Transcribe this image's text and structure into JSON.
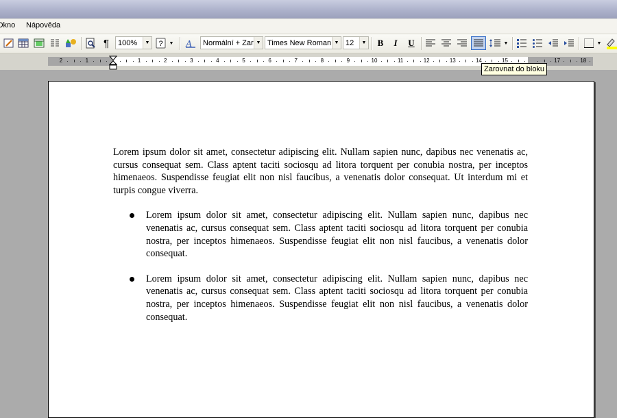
{
  "menu": {
    "items": [
      {
        "label": "Okno"
      },
      {
        "label": "Nápověda"
      }
    ]
  },
  "toolbar": {
    "zoom": "100%",
    "style": "Normální + Zarc",
    "font": "Times New Roman",
    "size": "12",
    "bold_label": "B",
    "italic_label": "I",
    "underline_label": "U",
    "pilcrow": "¶",
    "help_label": "?"
  },
  "ruler": {
    "numbers": [
      "2",
      "1",
      "1",
      "2",
      "3",
      "4",
      "5",
      "6",
      "7",
      "8",
      "9",
      "10",
      "11",
      "12",
      "13",
      "14",
      "15",
      "17",
      "18"
    ]
  },
  "tooltip": "Zarovnat do bloku",
  "document": {
    "paragraph": "Lorem ipsum dolor sit amet, consectetur adipiscing elit. Nullam sapien nunc, dapibus nec venenatis ac, cursus consequat sem. Class aptent taciti sociosqu ad litora torquent per conubia nostra, per inceptos himenaeos. Suspendisse feugiat elit non nisl faucibus, a venenatis dolor consequat. Ut interdum mi et turpis congue viverra.",
    "bullets": [
      "Lorem ipsum dolor sit amet, consectetur adipiscing elit. Nullam sapien nunc, dapibus nec venenatis ac, cursus consequat sem. Class aptent taciti sociosqu ad litora torquent per conubia nostra, per inceptos himenaeos. Suspendisse feugiat elit non nisl faucibus, a venenatis dolor consequat.",
      "Lorem ipsum dolor sit amet, consectetur adipiscing elit. Nullam sapien nunc, dapibus nec venenatis ac, cursus consequat sem. Class aptent taciti sociosqu ad litora torquent per conubia nostra, per inceptos himenaeos. Suspendisse feugiat elit non nisl faucibus, a venenatis dolor consequat."
    ]
  }
}
